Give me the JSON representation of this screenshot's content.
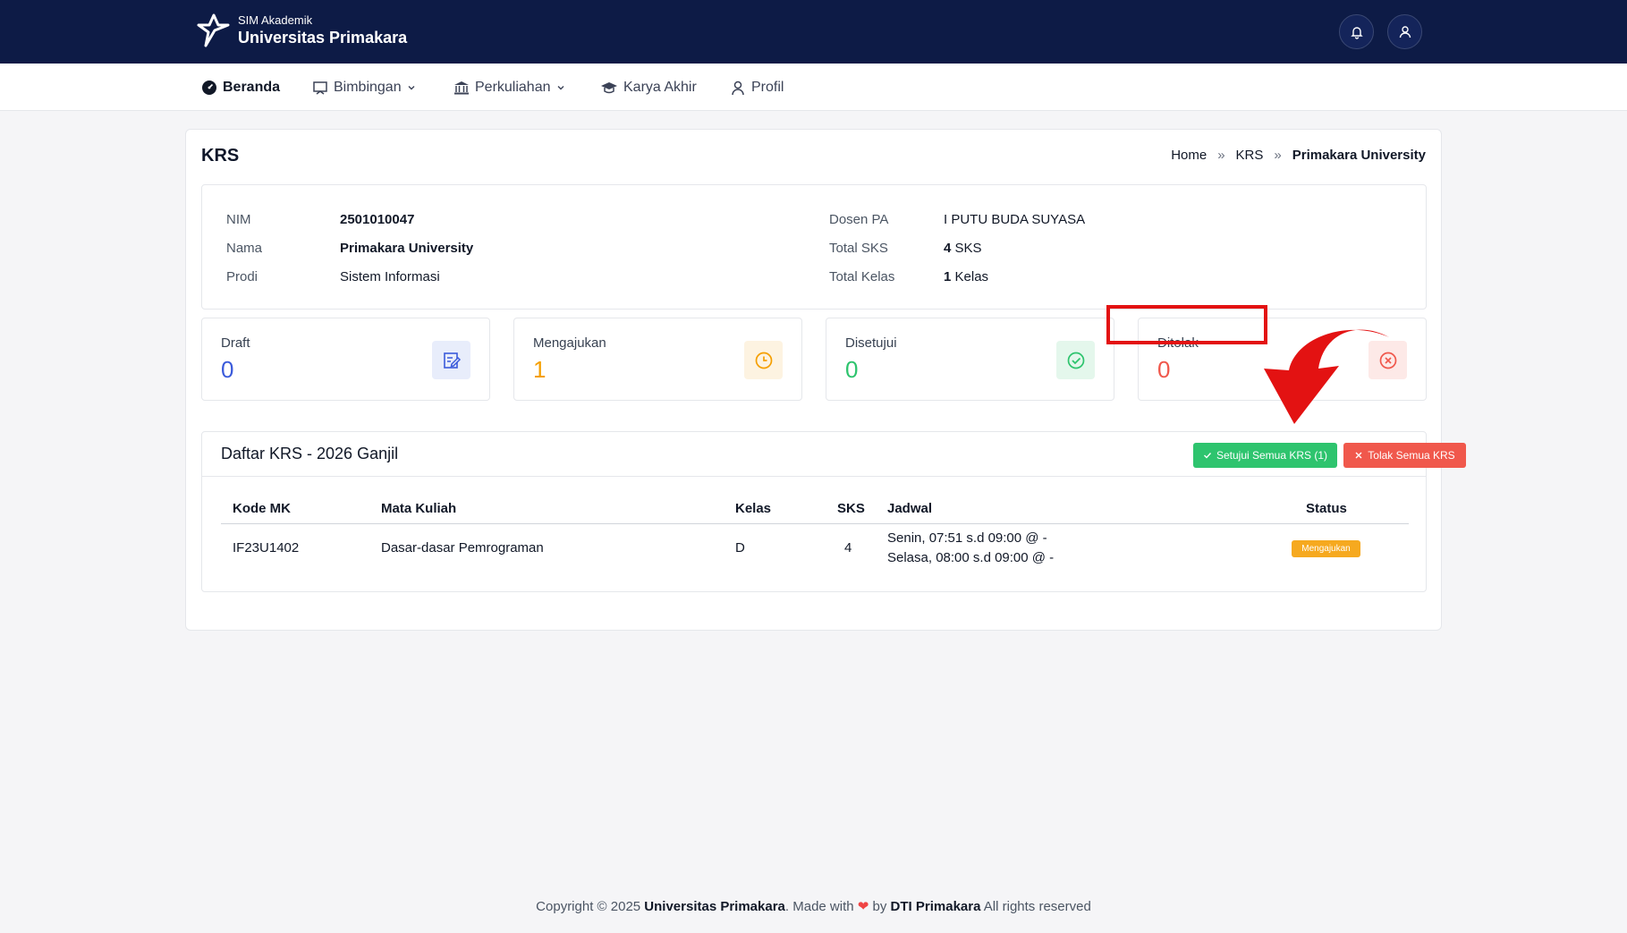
{
  "header": {
    "app_sub": "SIM Akademik",
    "app_title": "Universitas Primakara"
  },
  "nav": {
    "items": [
      {
        "label": "Beranda",
        "icon": "dashboard-icon"
      },
      {
        "label": "Bimbingan",
        "icon": "presentation-icon"
      },
      {
        "label": "Perkuliahan",
        "icon": "building-icon"
      },
      {
        "label": "Karya Akhir",
        "icon": "graduation-cap-icon"
      },
      {
        "label": "Profil",
        "icon": "user-icon"
      }
    ]
  },
  "page": {
    "title": "KRS",
    "breadcrumb": [
      "Home",
      "KRS",
      "Primakara University"
    ],
    "breadcrumb_sep": "»"
  },
  "student": {
    "nim_label": "NIM",
    "nim": "2501010047",
    "nama_label": "Nama",
    "nama": "Primakara University",
    "prodi_label": "Prodi",
    "prodi": "Sistem Informasi",
    "dosen_label": "Dosen PA",
    "dosen": "I PUTU BUDA SUYASA",
    "sks_label": "Total SKS",
    "sks_num": "4",
    "sks_unit": " SKS",
    "kelas_label": "Total Kelas",
    "kelas_num": "1",
    "kelas_unit": " Kelas"
  },
  "stats": [
    {
      "label": "Draft",
      "value": "0",
      "color": "#3b5bdb",
      "bg": "#e8edfb",
      "icon": "edit-icon"
    },
    {
      "label": "Mengajukan",
      "value": "1",
      "color": "#f59f00",
      "bg": "#fdf3e1",
      "icon": "clock-icon"
    },
    {
      "label": "Disetujui",
      "value": "0",
      "color": "#2ec46e",
      "bg": "#e4f7ec",
      "icon": "check-circle-icon"
    },
    {
      "label": "Ditolak",
      "value": "0",
      "color": "#f0584c",
      "bg": "#fde9e7",
      "icon": "x-circle-icon"
    }
  ],
  "krs": {
    "title": "Daftar KRS - 2026 Ganjil",
    "approve_label": "Setujui Semua KRS (1)",
    "reject_label": "Tolak Semua KRS",
    "columns": [
      "Kode MK",
      "Mata Kuliah",
      "Kelas",
      "SKS",
      "Jadwal",
      "Status"
    ],
    "rows": [
      {
        "kode": "IF23U1402",
        "mata_kuliah": "Dasar-dasar Pemrograman",
        "kelas": "D",
        "sks": "4",
        "jadwal": [
          "Senin, 07:51 s.d 09:00 @ -",
          "Selasa, 08:00 s.d 09:00 @ -"
        ],
        "status": "Mengajukan"
      }
    ]
  },
  "footer": {
    "prefix": "Copyright © 2025 ",
    "org": "Universitas Primakara",
    "made_with": ". Made with ",
    "by": " by ",
    "team": "DTI Primakara",
    "suffix": " All rights reserved"
  },
  "colors": {
    "navy": "#0d1b46",
    "approve": "#2ec46e",
    "reject": "#f0584c",
    "pending": "#f6a91f",
    "annotation": "#e31212"
  }
}
